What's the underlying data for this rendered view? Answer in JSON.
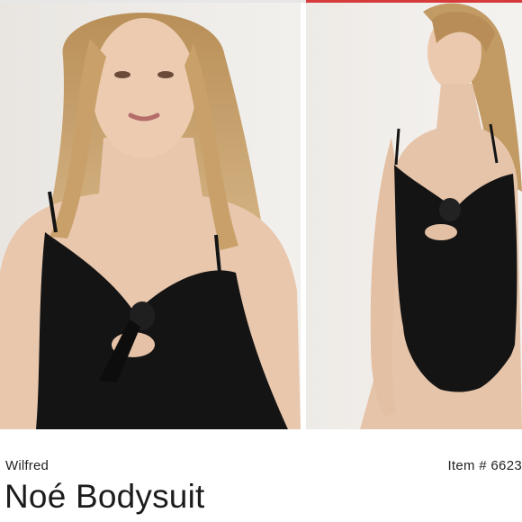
{
  "listing": {
    "brand": "Wilfred",
    "item_number": "Item # 6623",
    "title": "Noé Bodysuit"
  },
  "photos": [
    {
      "view": "front close-up",
      "alt": "Model wearing black tie-front bodysuit, close-up"
    },
    {
      "view": "full body",
      "alt": "Model wearing black tie-front bodysuit, standing"
    }
  ],
  "colors": {
    "accent": "#d63a3a",
    "garment": "#141414",
    "text": "#222222",
    "background": "#ffffff"
  }
}
